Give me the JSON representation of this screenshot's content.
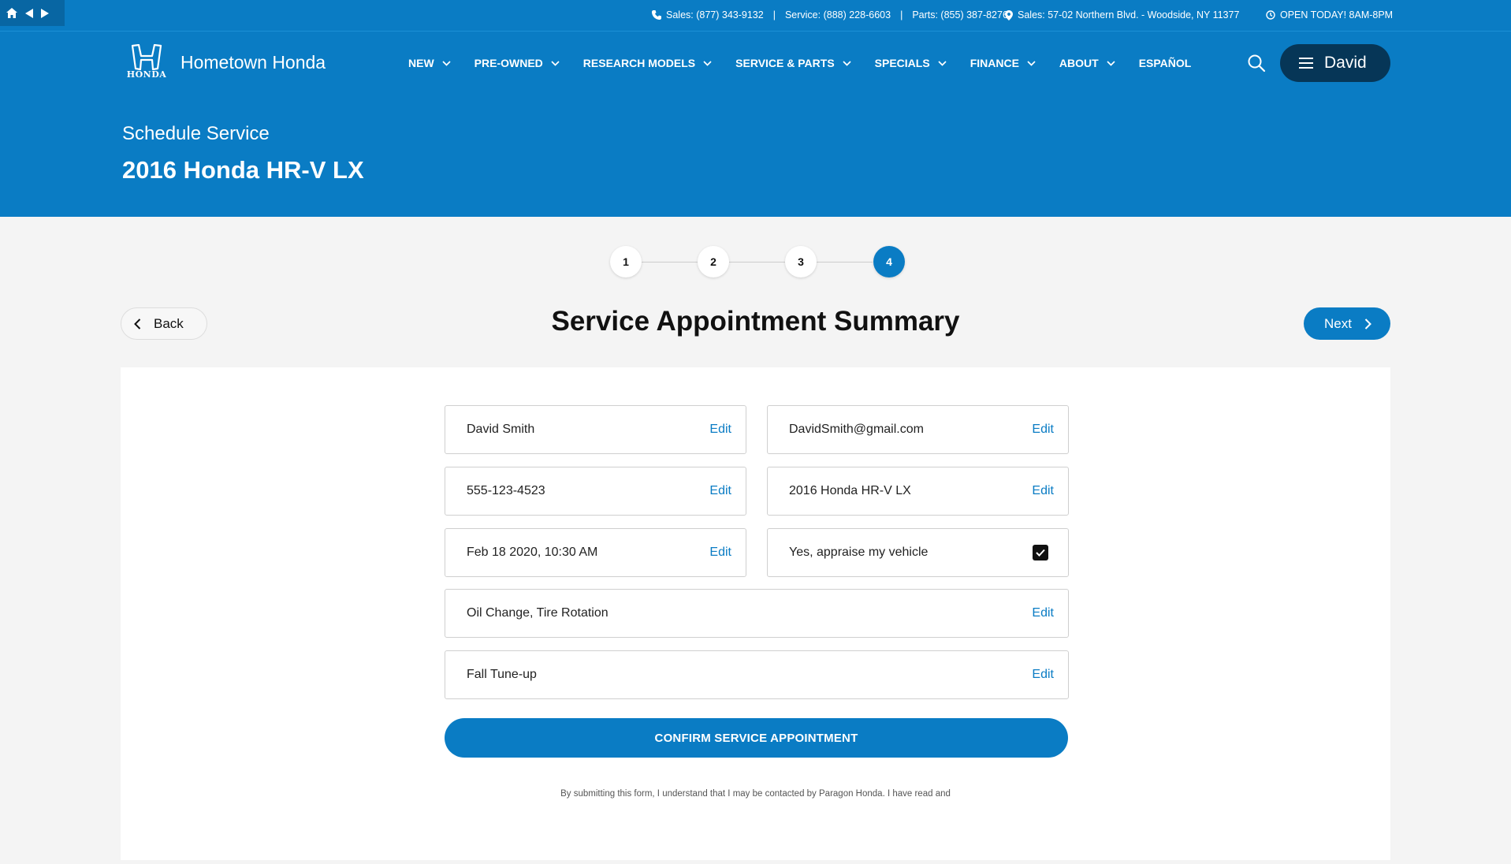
{
  "browser": {
    "icons": [
      "home-icon",
      "back-arrow-icon",
      "forward-arrow-icon"
    ]
  },
  "topbar": {
    "sales_phone": "Sales: (877) 343-9132",
    "service_phone": "Service: (888) 228-6603",
    "parts_phone": "Parts: (855) 387-8276",
    "address": "Sales: 57-02 Northern Blvd. - Woodside, NY 11377",
    "hours": "OPEN TODAY! 8AM-8PM",
    "separator": "|"
  },
  "header": {
    "logo_word": "HONDA",
    "site_name": "Hometown Honda",
    "nav": [
      {
        "label": "NEW",
        "has_dropdown": true
      },
      {
        "label": "PRE-OWNED",
        "has_dropdown": true
      },
      {
        "label": "RESEARCH MODELS",
        "has_dropdown": true
      },
      {
        "label": "SERVICE & PARTS",
        "has_dropdown": true
      },
      {
        "label": "SPECIALS",
        "has_dropdown": true
      },
      {
        "label": "FINANCE",
        "has_dropdown": true
      },
      {
        "label": "ABOUT",
        "has_dropdown": true
      },
      {
        "label": "ESPAÑOL",
        "has_dropdown": false
      }
    ],
    "user_name": "David",
    "subtitle": "Schedule Service",
    "title": "2016 Honda HR-V LX"
  },
  "stepper": {
    "steps": [
      "1",
      "2",
      "3",
      "4"
    ],
    "active": 4
  },
  "actions": {
    "back_label": "Back",
    "next_label": "Next"
  },
  "summary": {
    "title": "Service Appointment Summary",
    "edit_label": "Edit",
    "name": "David Smith",
    "email": "DavidSmith@gmail.com",
    "phone": "555-123-4523",
    "vehicle": "2016 Honda HR-V LX",
    "datetime": "Feb 18 2020, 10:30 AM",
    "appraise_label": "Yes, appraise my vehicle",
    "appraise_checked": true,
    "services": "Oil Change, Tire Rotation",
    "package": "Fall Tune-up",
    "confirm_label": "CONFIRM SERVICE APPOINTMENT",
    "disclaimer": "By submitting this form, I understand that I may be contacted by Paragon Honda. I have read and"
  },
  "colors": {
    "brand": "#0a7cc4",
    "brand_dark": "#063657",
    "link": "#0a7cc4",
    "page_bg": "#f4f4f4"
  }
}
